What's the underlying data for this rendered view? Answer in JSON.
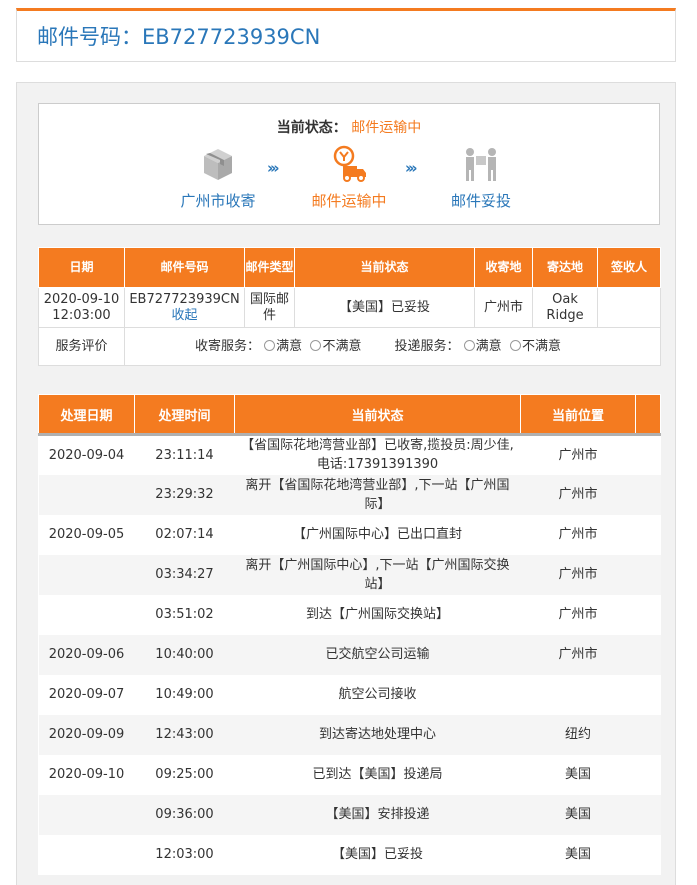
{
  "header": {
    "title": "邮件号码：EB727723939CN"
  },
  "status_panel": {
    "label": "当前状态：",
    "value": "邮件运输中",
    "steps": [
      {
        "label": "广州市收寄",
        "icon": "package-box-icon",
        "state": "done"
      },
      {
        "label": "邮件运输中",
        "icon": "delivery-truck-icon",
        "state": "active"
      },
      {
        "label": "邮件妥投",
        "icon": "courier-handover-icon",
        "state": "pending"
      }
    ],
    "arrow_glyph": "›››"
  },
  "summary_table": {
    "headers": [
      "日期",
      "邮件号码",
      "邮件类型",
      "当前状态",
      "收寄地",
      "寄达地",
      "签收人"
    ],
    "row": {
      "date": "2020-09-10 12:03:00",
      "tracking_no": "EB727723939CN",
      "collapse_link": "收起",
      "mail_type": "国际邮件",
      "status": "【美国】已妥投",
      "origin": "广州市",
      "destination": "Oak Ridge",
      "signer": ""
    },
    "rating": {
      "label": "服务评价",
      "pickup_label": "收寄服务：",
      "delivery_label": "投递服务：",
      "satisfied": "满意",
      "unsatisfied": "不满意"
    }
  },
  "events_table": {
    "headers": [
      "处理日期",
      "处理时间",
      "当前状态",
      "当前位置"
    ],
    "rows": [
      {
        "date": "2020-09-04",
        "time": "23:11:14",
        "status": "【省国际花地湾营业部】已收寄,揽投员:周少佳,电话:17391391390",
        "location": "广州市"
      },
      {
        "date": "",
        "time": "23:29:32",
        "status": "离开【省国际花地湾营业部】,下一站【广州国际】",
        "location": "广州市"
      },
      {
        "date": "2020-09-05",
        "time": "02:07:14",
        "status": "【广州国际中心】已出口直封",
        "location": "广州市"
      },
      {
        "date": "",
        "time": "03:34:27",
        "status": "离开【广州国际中心】,下一站【广州国际交换站】",
        "location": "广州市"
      },
      {
        "date": "",
        "time": "03:51:02",
        "status": "到达【广州国际交换站】",
        "location": "广州市"
      },
      {
        "date": "2020-09-06",
        "time": "10:40:00",
        "status": "已交航空公司运输",
        "location": "广州市"
      },
      {
        "date": "2020-09-07",
        "time": "10:49:00",
        "status": "航空公司接收",
        "location": ""
      },
      {
        "date": "2020-09-09",
        "time": "12:43:00",
        "status": "到达寄达地处理中心",
        "location": "纽约"
      },
      {
        "date": "2020-09-10",
        "time": "09:25:00",
        "status": "已到达【美国】投递局",
        "location": "美国"
      },
      {
        "date": "",
        "time": "09:36:00",
        "status": "【美国】安排投递",
        "location": "美国"
      },
      {
        "date": "",
        "time": "12:03:00",
        "status": "【美国】已妥投",
        "location": "美国"
      }
    ]
  },
  "colors": {
    "accent": "#f47b20",
    "link": "#2a77b9"
  }
}
